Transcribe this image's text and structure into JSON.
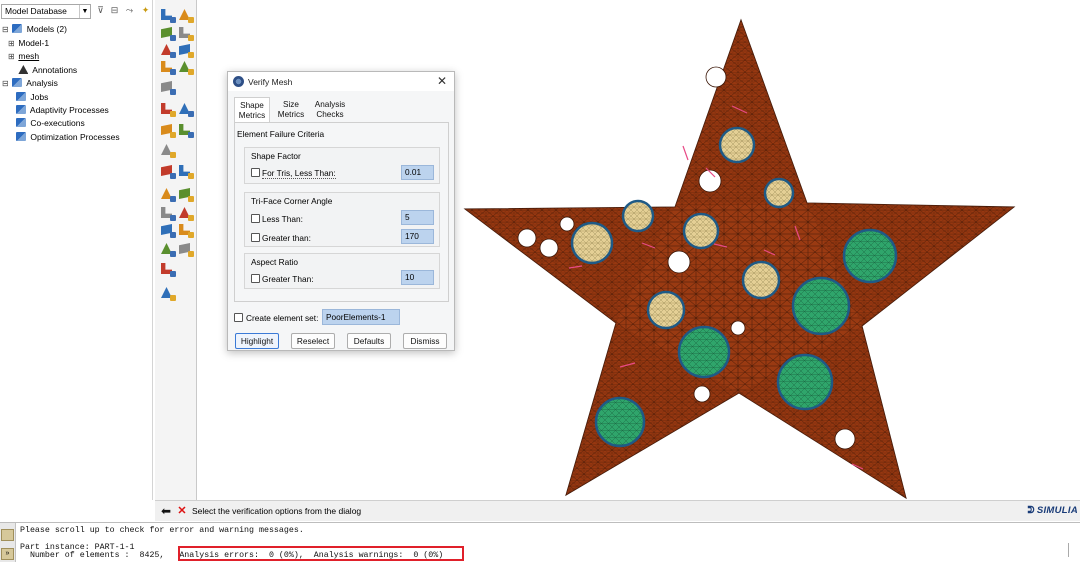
{
  "tree": {
    "selector": "Model Database",
    "items": [
      {
        "expander": "⊟",
        "label": "Models (2)"
      },
      {
        "expander": "⊞",
        "label": "Model-1"
      },
      {
        "expander": "⊞",
        "label": "mesh"
      },
      {
        "expander": "",
        "label": "Annotations"
      },
      {
        "expander": "⊟",
        "label": "Analysis"
      },
      {
        "expander": "",
        "label": "Jobs"
      },
      {
        "expander": "",
        "label": "Adaptivity Processes"
      },
      {
        "expander": "",
        "label": "Co-executions"
      },
      {
        "expander": "",
        "label": "Optimization Processes"
      }
    ]
  },
  "dialog": {
    "title": "Verify Mesh",
    "close": "✕",
    "tabs": [
      {
        "line1": "Shape",
        "line2": "Metrics"
      },
      {
        "line1": "Size",
        "line2": "Metrics"
      },
      {
        "line1": "Analysis",
        "line2": "Checks"
      }
    ],
    "criteria_label": "Element Failure Criteria",
    "shape_factor": {
      "label": "Shape Factor",
      "option": "For Tris, Less Than:",
      "value": "0.01"
    },
    "corner_angle": {
      "label": "Tri-Face Corner Angle",
      "less_label": "Less Than:",
      "less_value": "5",
      "greater_label": "Greater than:",
      "greater_value": "170"
    },
    "aspect_ratio": {
      "label": "Aspect Ratio",
      "option": "Greater Than:",
      "value": "10"
    },
    "create_set_label": "Create element set:",
    "set_name": "PoorElements-1",
    "buttons": {
      "highlight": "Highlight",
      "reselect": "Reselect",
      "defaults": "Defaults",
      "dismiss": "Dismiss"
    }
  },
  "prompt": {
    "text": "Select the verification options from the dialog",
    "back": "⬅",
    "cancel": "✕"
  },
  "brand": "SIMULIA",
  "messages": {
    "line1": "Please scroll up to check for error and warning messages.",
    "line2": "Part instance: PART-1-1",
    "line3": "  Number of elements :  8425,   Analysis errors:  0 (0%),  Analysis warnings:  0 (0%)"
  },
  "colors": {
    "mesh_fill": "#9a3a12",
    "mesh_line": "#3a1506",
    "inclusion_tan": "#e4cf95",
    "inclusion_green": "#2fa56b",
    "inclusion_rim": "#1f5a86",
    "highlight_box": "#e0202a",
    "poor_element": "#e84a86"
  }
}
